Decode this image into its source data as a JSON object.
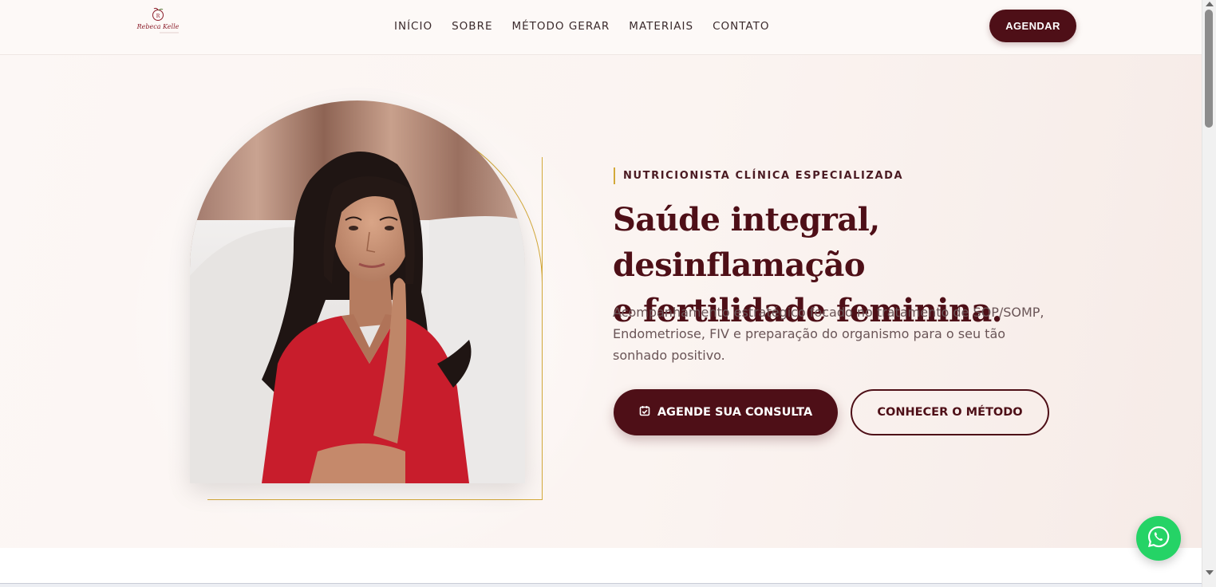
{
  "brand": {
    "logo_text": "Rebeca Kelle",
    "logo_sub": "NUTRICIONISTA"
  },
  "nav": {
    "items": [
      "INÍCIO",
      "SOBRE",
      "MÉTODO GERAR",
      "MATERIAIS",
      "CONTATO"
    ]
  },
  "header": {
    "cta_label": "AGENDAR"
  },
  "hero": {
    "eyebrow": "NUTRICIONISTA CLÍNICA ESPECIALIZADA",
    "headline_line1": "Saúde integral, desinflamação",
    "headline_line2": "e fertilidade feminina.",
    "lead": "Acompanhamento estratégico focado no tratamento de SOP/SOMP, Endometriose, FIV e preparação do organismo para o seu tão sonhado positivo.",
    "primary_cta": "AGENDE SUA CONSULTA",
    "secondary_cta": "CONHECER O MÉTODO"
  },
  "icons": {
    "primary_cta_icon": "calendar-check-icon",
    "floating": "whatsapp-icon"
  },
  "colors": {
    "brand": "#4e0f17",
    "accent_gold": "#d3a93a",
    "whatsapp": "#25d366"
  }
}
